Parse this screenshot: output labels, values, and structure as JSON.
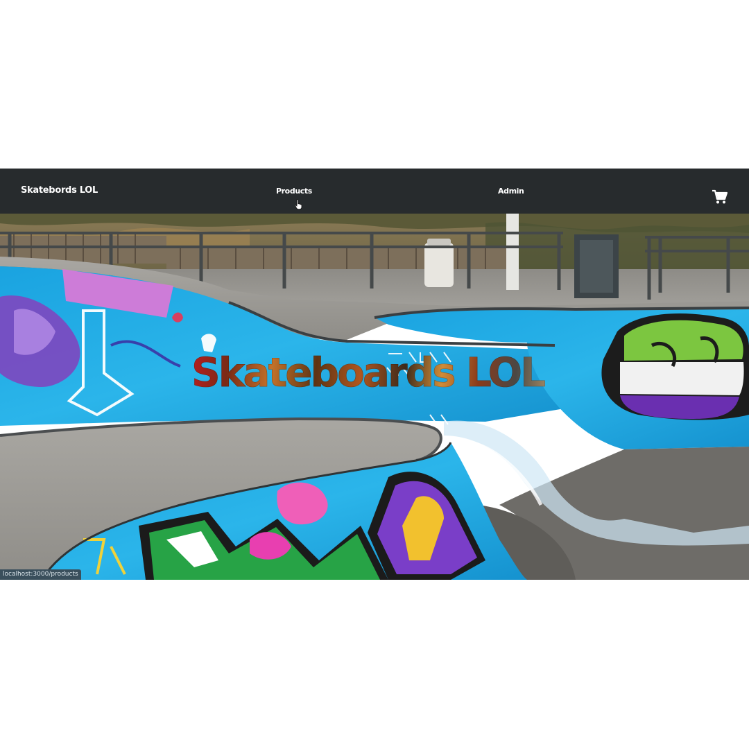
{
  "navbar": {
    "brand": "Skatebords LOL",
    "links": [
      {
        "label": "Products"
      },
      {
        "label": "Admin"
      }
    ],
    "cart_icon": "shopping-cart-icon",
    "background": "#272b2d"
  },
  "hero": {
    "title": "Skateboards LOL"
  },
  "status_bar": {
    "url": "localhost:3000/products"
  }
}
